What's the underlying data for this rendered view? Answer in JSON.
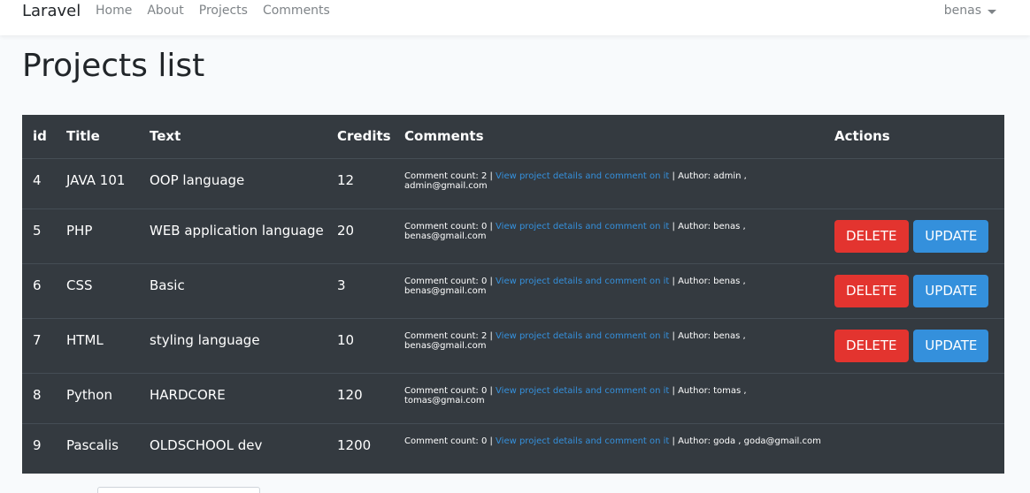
{
  "navbar": {
    "brand": "Laravel",
    "links": [
      "Home",
      "About",
      "Projects",
      "Comments"
    ],
    "user": "benas"
  },
  "page": {
    "title": "Projects list"
  },
  "table": {
    "headers": [
      "id",
      "Title",
      "Text",
      "Credits",
      "Comments",
      "Actions"
    ],
    "comment_prefix": "Comment count: ",
    "link_text": "View project details and comment on it",
    "author_prefix": " | Author: ",
    "delete_label": "DELETE",
    "update_label": "UPDATE",
    "rows": [
      {
        "id": "4",
        "title": "JAVA 101",
        "text": "OOP language",
        "credits": "12",
        "comment_count": "2",
        "author": "admin , admin@gmail.com",
        "actions": false
      },
      {
        "id": "5",
        "title": "PHP",
        "text": "WEB application language",
        "credits": "20",
        "comment_count": "0",
        "author": "benas , benas@gmail.com",
        "actions": true
      },
      {
        "id": "6",
        "title": "CSS",
        "text": "Basic",
        "credits": "3",
        "comment_count": "0",
        "author": "benas , benas@gmail.com",
        "actions": true
      },
      {
        "id": "7",
        "title": "HTML",
        "text": "styling language",
        "credits": "10",
        "comment_count": "2",
        "author": "benas , benas@gmail.com",
        "actions": true
      },
      {
        "id": "8",
        "title": "Python",
        "text": "HARDCORE",
        "credits": "120",
        "comment_count": "0",
        "author": "tomas , tomas@gmai.com",
        "actions": false
      },
      {
        "id": "9",
        "title": "Pascalis",
        "text": "OLDSCHOOL dev",
        "credits": "1200",
        "comment_count": "0",
        "author": "goda , goda@gmail.com",
        "actions": false
      }
    ]
  },
  "colors": {
    "navbar_bg": "#ffffff",
    "table_bg": "#343a40",
    "delete": "#e3342f",
    "update": "#3490dc",
    "link": "#3490dc"
  }
}
